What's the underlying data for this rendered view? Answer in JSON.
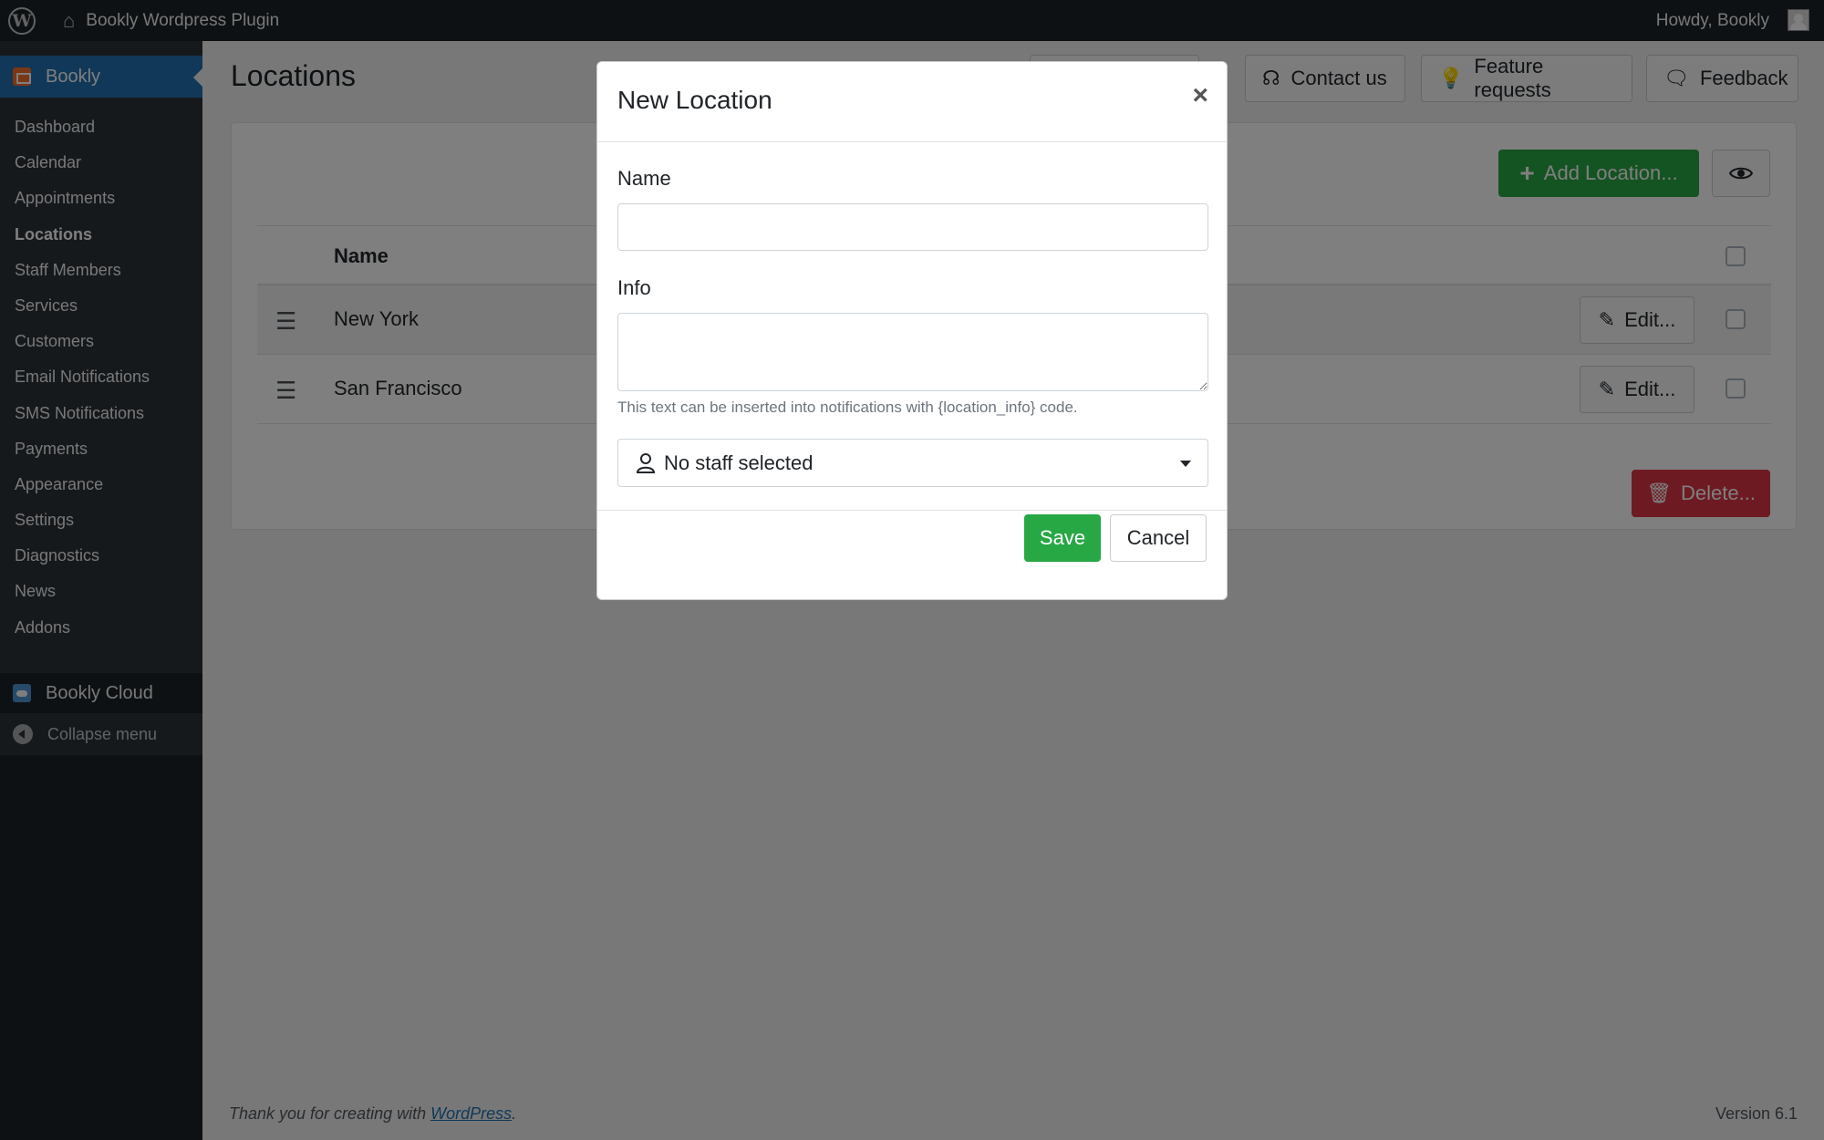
{
  "adminbar": {
    "site_name": "Bookly Wordpress Plugin",
    "howdy": "Howdy, Bookly"
  },
  "sidebar": {
    "current_app": "Bookly",
    "items": [
      {
        "label": "Dashboard"
      },
      {
        "label": "Calendar"
      },
      {
        "label": "Appointments"
      },
      {
        "label": "Locations"
      },
      {
        "label": "Staff Members"
      },
      {
        "label": "Services"
      },
      {
        "label": "Customers"
      },
      {
        "label": "Email Notifications"
      },
      {
        "label": "SMS Notifications"
      },
      {
        "label": "Payments"
      },
      {
        "label": "Appearance"
      },
      {
        "label": "Settings"
      },
      {
        "label": "Diagnostics"
      },
      {
        "label": "News"
      },
      {
        "label": "Addons"
      }
    ],
    "cloud": "Bookly Cloud",
    "collapse": "Collapse menu"
  },
  "page": {
    "title": "Locations",
    "top_buttons": {
      "contact": "Contact us",
      "features": "Feature requests",
      "feedback": "Feedback"
    },
    "add_location": "Add Location...",
    "table": {
      "header_name": "Name",
      "rows": [
        {
          "name": "New York",
          "edit": "Edit..."
        },
        {
          "name": "San Francisco",
          "edit": "Edit..."
        }
      ]
    },
    "delete": "Delete..."
  },
  "footer": {
    "thanks_prefix": "Thank you for creating with ",
    "thanks_link": "WordPress",
    "thanks_suffix": ".",
    "version": "Version 6.1"
  },
  "modal": {
    "title": "New Location",
    "name_label": "Name",
    "name_value": "",
    "info_label": "Info",
    "info_value": "",
    "help_text": "This text can be inserted into notifications with {location_info} code.",
    "staff_select": "No staff selected",
    "save": "Save",
    "cancel": "Cancel"
  },
  "colors": {
    "accent_blue": "#2271b1",
    "success_green": "#28a745",
    "danger_red": "#dc3545",
    "admin_dark": "#1d2327"
  }
}
